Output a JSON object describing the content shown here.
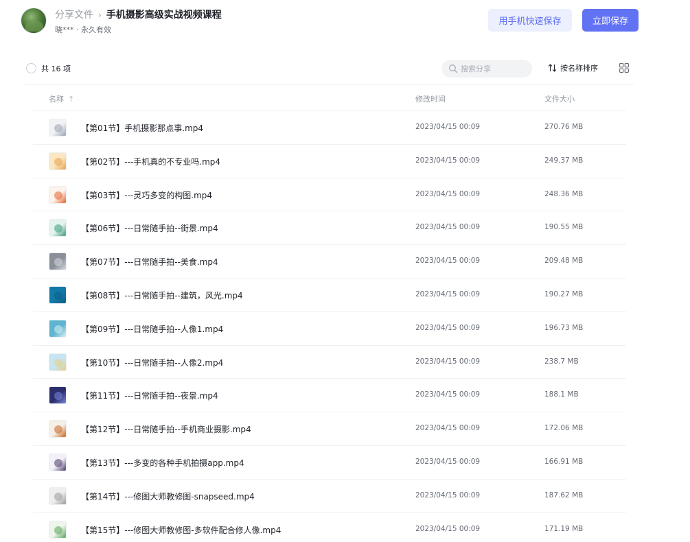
{
  "header": {
    "breadcrumb_root": "分享文件",
    "breadcrumb_separator": "›",
    "title": "手机摄影高级实战视频课程",
    "sharer": "晓*** · 永久有效",
    "phone_save_label": "用手机快速保存",
    "save_label": "立即保存"
  },
  "toolbar": {
    "count": "共 16 项",
    "search_placeholder": "搜索分享",
    "sort_label": "按名称排序"
  },
  "columns": {
    "name": "名称",
    "sort_arrow": "↑",
    "time": "修改时间",
    "size": "文件大小"
  },
  "files": [
    {
      "name": "【第01节】手机摄影那点事.mp4",
      "time": "2023/04/15 00:09",
      "size": "270.76 MB",
      "thumb_color": "#f1f2f4",
      "thumb_accent": "#9aa3b0"
    },
    {
      "name": "【第02节】---手机真的不专业吗.mp4",
      "time": "2023/04/15 00:09",
      "size": "249.37 MB",
      "thumb_color": "#fbe7c2",
      "thumb_accent": "#e8a14a"
    },
    {
      "name": "【第03节】---灵巧多变的构图.mp4",
      "time": "2023/04/15 00:09",
      "size": "248.36 MB",
      "thumb_color": "#fdf3ec",
      "thumb_accent": "#e3632c"
    },
    {
      "name": "【第06节】---日常随手拍--街景.mp4",
      "time": "2023/04/15 00:09",
      "size": "190.55 MB",
      "thumb_color": "#e3f4ee",
      "thumb_accent": "#3a9b7a"
    },
    {
      "name": "【第07节】---日常随手拍--美食.mp4",
      "time": "2023/04/15 00:09",
      "size": "209.48 MB",
      "thumb_color": "#8a8f99",
      "thumb_accent": "#d5d8de"
    },
    {
      "name": "【第08节】---日常随手拍--建筑，风光.mp4",
      "time": "2023/04/15 00:09",
      "size": "190.27 MB",
      "thumb_color": "#127aa8",
      "thumb_accent": "#0d5f85"
    },
    {
      "name": "【第09节】---日常随手拍--人像1.mp4",
      "time": "2023/04/15 00:09",
      "size": "196.73 MB",
      "thumb_color": "#5fb4cf",
      "thumb_accent": "#d9f0f6"
    },
    {
      "name": "【第10节】---日常随手拍--人像2.mp4",
      "time": "2023/04/15 00:09",
      "size": "238.7 MB",
      "thumb_color": "#c7e4f3",
      "thumb_accent": "#e9cf7a"
    },
    {
      "name": "【第11节】---日常随手拍--夜景.mp4",
      "time": "2023/04/15 00:09",
      "size": "188.1 MB",
      "thumb_color": "#2c2f6e",
      "thumb_accent": "#7a88d9"
    },
    {
      "name": "【第12节】---日常随手拍--手机商业摄影.mp4",
      "time": "2023/04/15 00:09",
      "size": "172.06 MB",
      "thumb_color": "#f6efe8",
      "thumb_accent": "#c9641f"
    },
    {
      "name": "【第13节】---多变的各种手机拍摄app.mp4",
      "time": "2023/04/15 00:09",
      "size": "166.91 MB",
      "thumb_color": "#f3f0f7",
      "thumb_accent": "#4a3a6b"
    },
    {
      "name": "【第14节】---修图大师教修图-snapseed.mp4",
      "time": "2023/04/15 00:09",
      "size": "187.62 MB",
      "thumb_color": "#eeeeee",
      "thumb_accent": "#9a9a9a"
    },
    {
      "name": "【第15节】---修图大师教修图-多软件配合修人像.mp4",
      "time": "2023/04/15 00:09",
      "size": "171.19 MB",
      "thumb_color": "#eef6ec",
      "thumb_accent": "#5aa35a"
    }
  ]
}
